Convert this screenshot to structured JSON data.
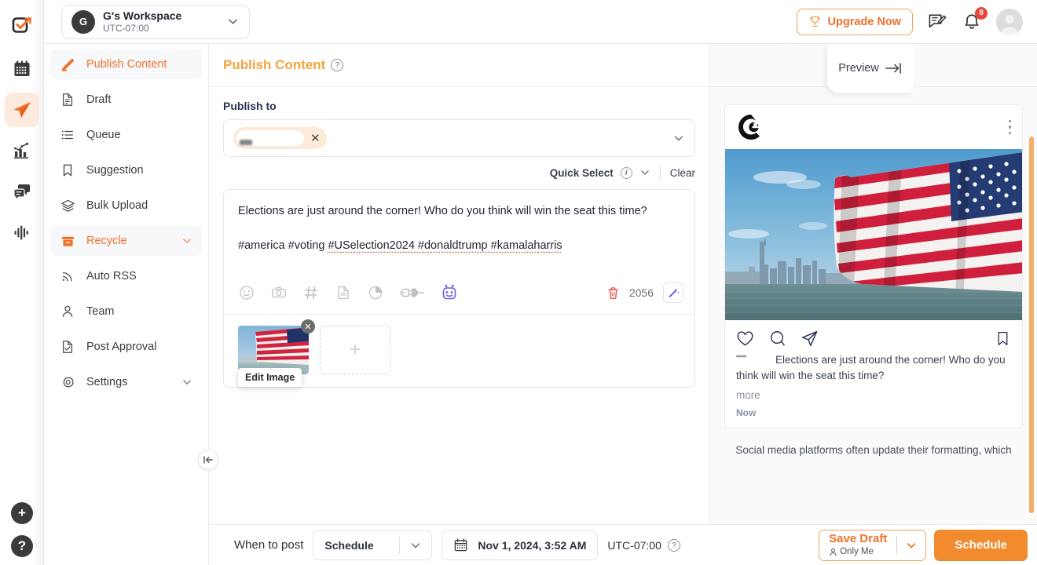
{
  "rail": {
    "items": [
      {
        "name": "app-logo",
        "icon": "checkbox-arrow-logo"
      },
      {
        "name": "calendar",
        "icon": "calendar-icon"
      },
      {
        "name": "publish",
        "icon": "paper-plane-icon",
        "active": true
      },
      {
        "name": "analytics",
        "icon": "chart-bar-icon"
      },
      {
        "name": "inbox",
        "icon": "chat-bubbles-icon"
      },
      {
        "name": "listening",
        "icon": "audio-wave-icon"
      }
    ],
    "add_label": "+",
    "help_label": "?"
  },
  "topbar": {
    "workspace": {
      "initial": "G",
      "name": "G's Workspace",
      "timezone": "UTC-07:00"
    },
    "upgrade_label": "Upgrade Now",
    "notifications_count": "8"
  },
  "sidebar": {
    "items": [
      {
        "label": "Publish Content",
        "icon": "pencil-icon",
        "active": true,
        "expandable": false
      },
      {
        "label": "Draft",
        "icon": "document-icon",
        "active": false,
        "expandable": false
      },
      {
        "label": "Queue",
        "icon": "list-icon",
        "active": false,
        "expandable": false
      },
      {
        "label": "Suggestion",
        "icon": "bookmark-icon",
        "active": false,
        "expandable": false
      },
      {
        "label": "Bulk Upload",
        "icon": "layers-icon",
        "active": false,
        "expandable": false
      },
      {
        "label": "Recycle",
        "icon": "recycle-box-icon",
        "active": true,
        "expandable": true
      },
      {
        "label": "Auto RSS",
        "icon": "rss-icon",
        "active": false,
        "expandable": false
      },
      {
        "label": "Team",
        "icon": "person-icon",
        "active": false,
        "expandable": false
      },
      {
        "label": "Post Approval",
        "icon": "document-check-icon",
        "active": false,
        "expandable": false
      },
      {
        "label": "Settings",
        "icon": "gear-icon",
        "active": false,
        "expandable": true
      }
    ]
  },
  "editor": {
    "title": "Publish Content",
    "publish_to_label": "Publish to",
    "selected_account": "",
    "quick_select_label": "Quick Select",
    "clear_label": "Clear",
    "compose": {
      "body": "Elections are just around the corner! Who do you think will win the seat this time?",
      "hashtags_plain": "#america #voting ",
      "hashtags_flagged": "#USelection2024 #donaldtrump #kamalaharris",
      "char_count": "2056"
    },
    "toolbar_icons": [
      "emoji-icon",
      "camera-icon",
      "hashtag-icon",
      "document-icon",
      "pie-chart-icon",
      "plug-icon",
      "ai-robot-icon"
    ],
    "media": {
      "edit_image_label": "Edit Image",
      "add_label": "+"
    }
  },
  "preview": {
    "float_tab_label": "Preview",
    "platform": "instagram",
    "post": {
      "username_redacted": "",
      "caption": "Elections are just around the corner! Who do you think will win the seat this time?",
      "more_label": "more",
      "timestamp": "Now"
    },
    "note": "Social media platforms often update their formatting, which"
  },
  "bottombar": {
    "when_label": "When to post",
    "schedule_mode": "Schedule",
    "date_value": "Nov 1, 2024, 3:52 AM",
    "timezone": "UTC-07:00",
    "save_draft_label": "Save Draft",
    "save_draft_sub": "Only Me",
    "schedule_button": "Schedule"
  },
  "colors": {
    "accent_orange": "#f2702a",
    "button_orange": "#f28a2e",
    "title_orange": "#f5a33d",
    "instagram_pink": "#e8336d",
    "badge_red": "#e8453c",
    "ai_purple": "#6c5ce7"
  }
}
